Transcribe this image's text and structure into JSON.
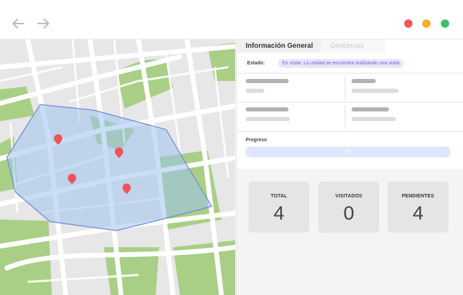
{
  "colors": {
    "close": "#ee5a5a",
    "minimize": "#f2ad2b",
    "maximize": "#3fbf6b",
    "geofence_fill": "#9fc3ef",
    "geofence_stroke": "#6f85d8",
    "map_pin": "#ef5454",
    "accent": "#6b5fd6"
  },
  "toolbar": {
    "back_icon": "arrow-left-icon",
    "forward_icon": "arrow-right-icon"
  },
  "window_controls": [
    "close",
    "minimize",
    "maximize"
  ],
  "map": {
    "pins": 4
  },
  "panel": {
    "tabs": [
      {
        "label": "Información General",
        "active": true
      },
      {
        "label": "Geocercas",
        "active": false
      }
    ],
    "status": {
      "label": "Estado:",
      "badge": "En visita: La unidad se encuentra realizando una visita"
    },
    "progress": {
      "label": "Progreso",
      "text": "0%",
      "value": 0
    },
    "stats": [
      {
        "label": "TOTAL",
        "value": "4"
      },
      {
        "label": "VISITADOS",
        "value": "0"
      },
      {
        "label": "PENDIENTES",
        "value": "4"
      }
    ]
  }
}
